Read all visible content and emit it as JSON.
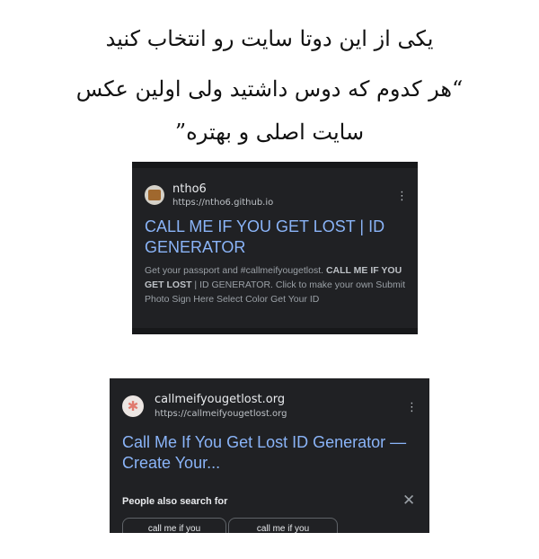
{
  "caption": {
    "line1": "یکی از این دوتا سایت رو انتخاب کنید",
    "line2": "“هر کدوم که دوس داشتید ولی اولین عکس",
    "line3": "سایت اصلی و بهتره”"
  },
  "result1": {
    "site_name": "ntho6",
    "url": "https://ntho6.github.io",
    "title": "CALL ME IF YOU GET LOST | ID GENERATOR",
    "snippet_1": "Get your passport and #callmeifyougetlost.",
    "snippet_bold": "CALL ME IF YOU GET LOST",
    "snippet_2": "| ID GENERATOR. Click to make your own Submit Photo Sign Here Select Color Get Your ID",
    "menu_icon": "⋮"
  },
  "result2": {
    "site_name": "callmeifyougetlost.org",
    "url": "https://callmeifyougetlost.org",
    "title": "Call Me If You Get Lost ID Generator — Create Your...",
    "menu_icon": "⋮",
    "people_also_search": {
      "heading": "People also search for",
      "close_icon": "✕",
      "chips": [
        "call me if you",
        "call me if you"
      ]
    }
  },
  "colors": {
    "card_bg": "#202124",
    "link_blue": "#8ab4f8",
    "text_primary": "#e8eaed",
    "text_secondary": "#bdc1c6"
  }
}
